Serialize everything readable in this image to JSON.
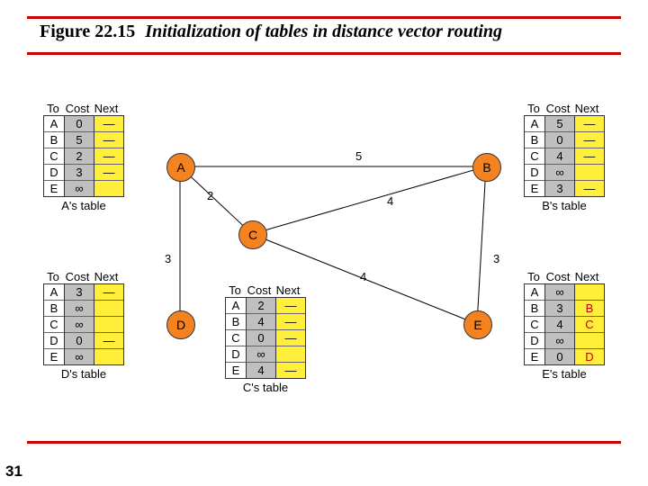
{
  "figure": {
    "number": "Figure 22.15",
    "title": "Initialization of tables in distance vector routing"
  },
  "page_number": "31",
  "headers": {
    "to": "To",
    "cost": "Cost",
    "next": "Next"
  },
  "tables": {
    "A": {
      "caption": "A's table",
      "rows": [
        {
          "to": "A",
          "cost": "0",
          "next": "—"
        },
        {
          "to": "B",
          "cost": "5",
          "next": "—"
        },
        {
          "to": "C",
          "cost": "2",
          "next": "—"
        },
        {
          "to": "D",
          "cost": "3",
          "next": "—"
        },
        {
          "to": "E",
          "cost": "∞",
          "next": ""
        }
      ]
    },
    "B": {
      "caption": "B's table",
      "rows": [
        {
          "to": "A",
          "cost": "5",
          "next": "—"
        },
        {
          "to": "B",
          "cost": "0",
          "next": "—"
        },
        {
          "to": "C",
          "cost": "4",
          "next": "—"
        },
        {
          "to": "D",
          "cost": "∞",
          "next": ""
        },
        {
          "to": "E",
          "cost": "3",
          "next": "—"
        }
      ]
    },
    "C": {
      "caption": "C's table",
      "rows": [
        {
          "to": "A",
          "cost": "2",
          "next": "—"
        },
        {
          "to": "B",
          "cost": "4",
          "next": "—"
        },
        {
          "to": "C",
          "cost": "0",
          "next": "—"
        },
        {
          "to": "D",
          "cost": "∞",
          "next": ""
        },
        {
          "to": "E",
          "cost": "4",
          "next": "—"
        }
      ]
    },
    "D": {
      "caption": "D's table",
      "rows": [
        {
          "to": "A",
          "cost": "3",
          "next": "—"
        },
        {
          "to": "B",
          "cost": "∞",
          "next": ""
        },
        {
          "to": "C",
          "cost": "∞",
          "next": ""
        },
        {
          "to": "D",
          "cost": "0",
          "next": "—"
        },
        {
          "to": "E",
          "cost": "∞",
          "next": ""
        }
      ]
    },
    "E": {
      "caption": "E's table",
      "rows": [
        {
          "to": "A",
          "cost": "∞",
          "next": ""
        },
        {
          "to": "B",
          "cost": "3",
          "next": "B"
        },
        {
          "to": "C",
          "cost": "4",
          "next": "C"
        },
        {
          "to": "D",
          "cost": "∞",
          "next": ""
        },
        {
          "to": "E",
          "cost": "0",
          "next": "D"
        }
      ]
    }
  },
  "nodes": {
    "A": "A",
    "B": "B",
    "C": "C",
    "D": "D",
    "E": "E"
  },
  "edges": {
    "AB": "5",
    "AC": "2",
    "AD": "3",
    "BC": "4",
    "BE": "3",
    "CE": "4"
  }
}
